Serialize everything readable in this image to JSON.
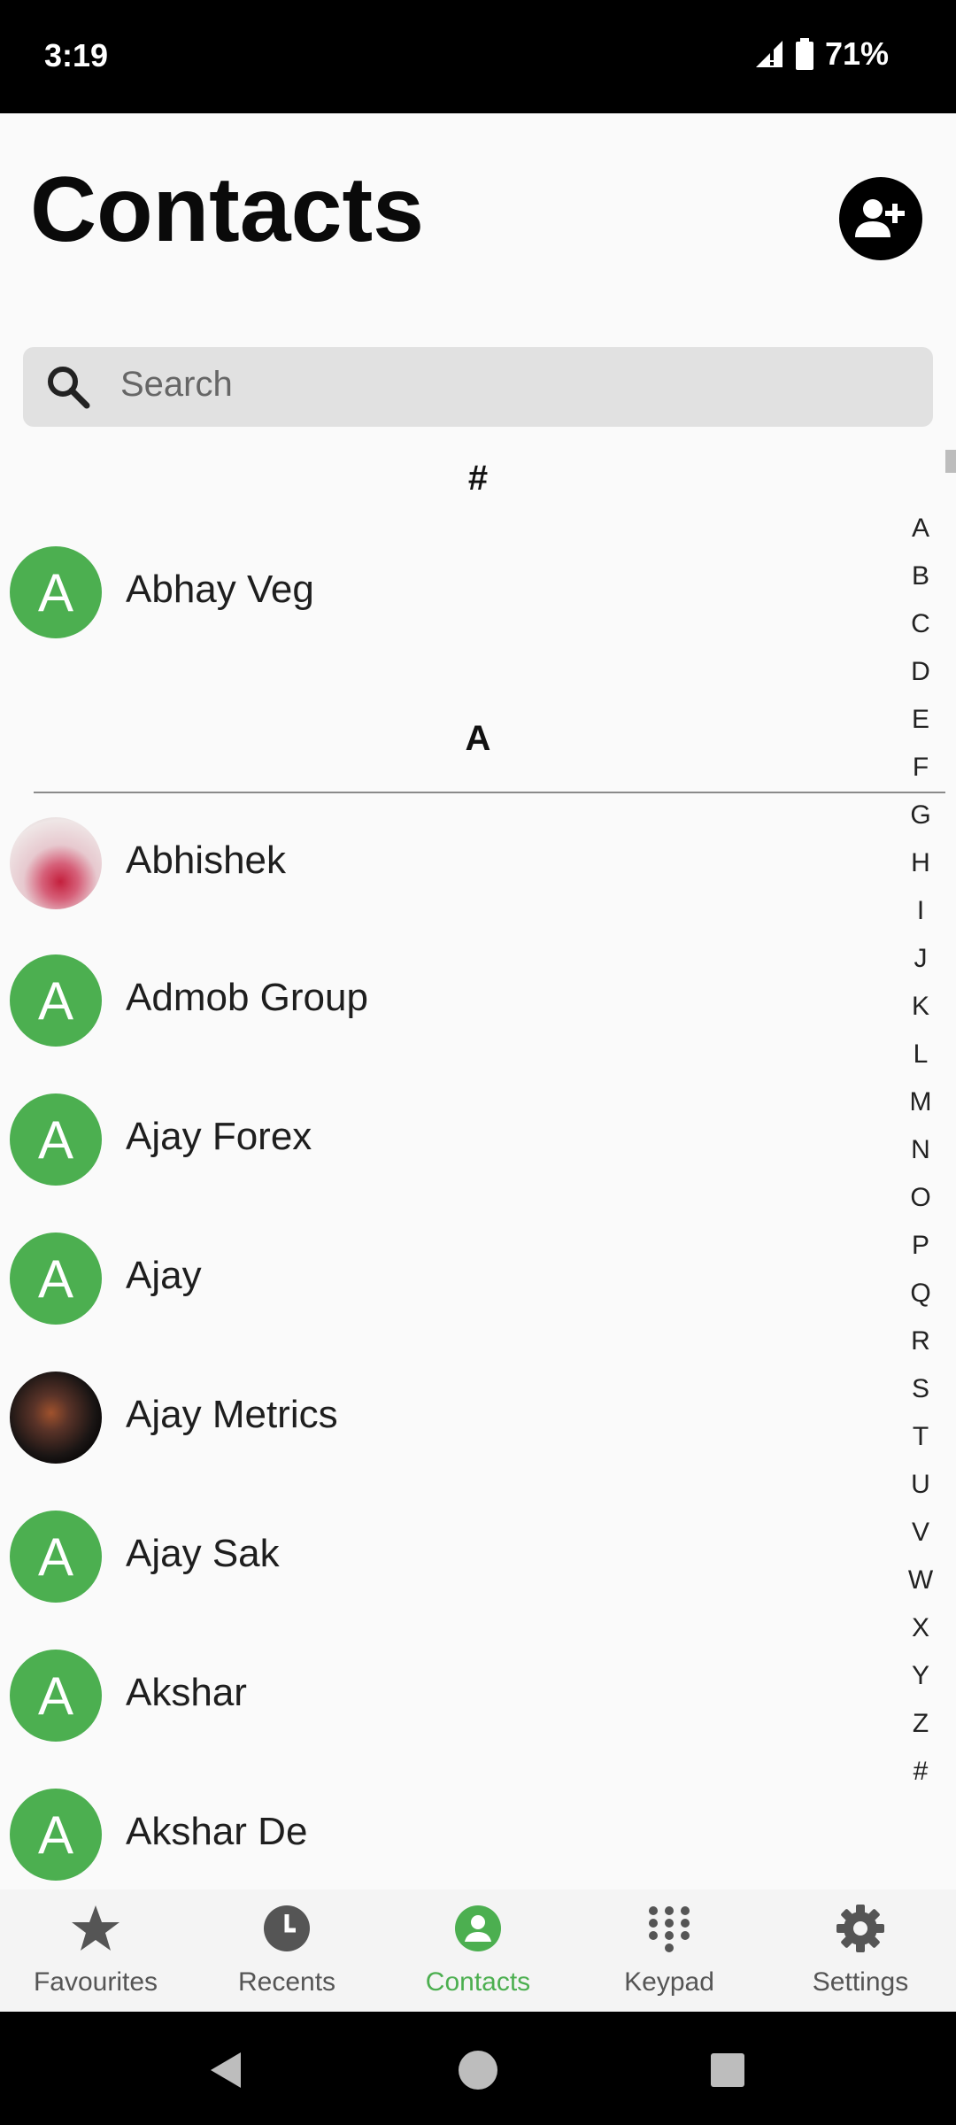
{
  "status": {
    "time": "3:19",
    "battery": "71%"
  },
  "header": {
    "title": "Contacts"
  },
  "search": {
    "placeholder": "Search"
  },
  "sections": [
    {
      "header": "#",
      "contacts": [
        {
          "name": "Abhay Veg",
          "initial": "A"
        }
      ]
    },
    {
      "header": "A",
      "contacts": [
        {
          "name": "Abhishek",
          "initial": ""
        },
        {
          "name": "Admob Group",
          "initial": "A"
        },
        {
          "name": "Ajay Forex",
          "initial": "A"
        },
        {
          "name": "Ajay",
          "initial": "A"
        },
        {
          "name": "Ajay Metrics",
          "initial": ""
        },
        {
          "name": "Ajay Sak",
          "initial": "A"
        },
        {
          "name": "Akshar",
          "initial": "A"
        },
        {
          "name": "Akshar De",
          "initial": "A"
        }
      ]
    }
  ],
  "index": [
    "A",
    "B",
    "C",
    "D",
    "E",
    "F",
    "G",
    "H",
    "I",
    "J",
    "K",
    "L",
    "M",
    "N",
    "O",
    "P",
    "Q",
    "R",
    "S",
    "T",
    "U",
    "V",
    "W",
    "X",
    "Y",
    "Z",
    "#"
  ],
  "nav": [
    {
      "label": "Favourites",
      "icon": "star-icon"
    },
    {
      "label": "Recents",
      "icon": "clock-icon"
    },
    {
      "label": "Contacts",
      "icon": "person-icon"
    },
    {
      "label": "Keypad",
      "icon": "dialpad-icon"
    },
    {
      "label": "Settings",
      "icon": "gear-icon"
    }
  ],
  "colors": {
    "accent": "#4caf50",
    "statusbar": "#000000"
  }
}
